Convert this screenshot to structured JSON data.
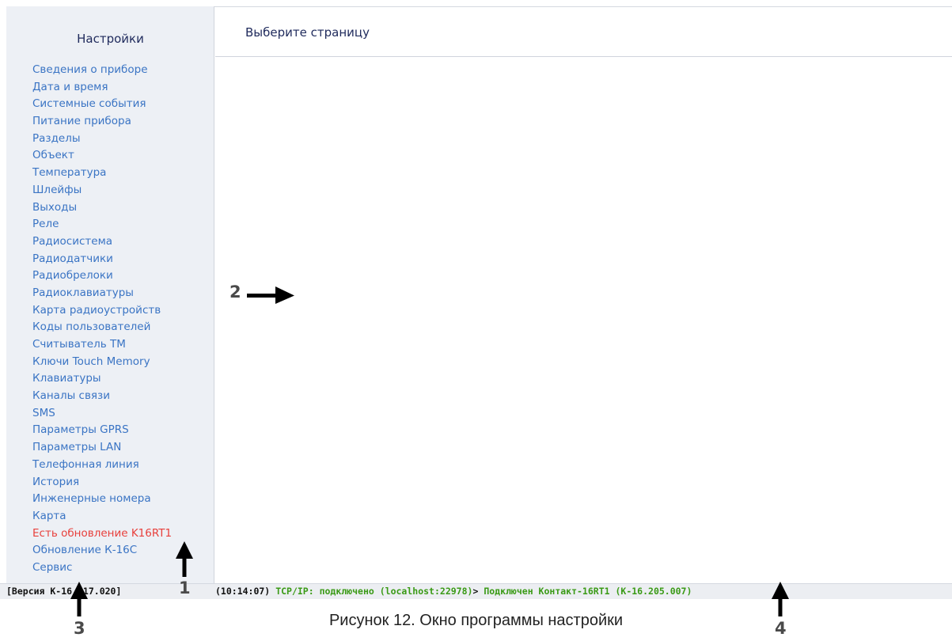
{
  "sidebar": {
    "title": "Настройки",
    "items": [
      {
        "label": "Сведения о приборе"
      },
      {
        "label": "Дата и время"
      },
      {
        "label": "Системные события"
      },
      {
        "label": "Питание прибора"
      },
      {
        "label": "Разделы"
      },
      {
        "label": "Объект"
      },
      {
        "label": "Температура"
      },
      {
        "label": "Шлейфы"
      },
      {
        "label": "Выходы"
      },
      {
        "label": "Реле"
      },
      {
        "label": "Радиосистема"
      },
      {
        "label": "Радиодатчики"
      },
      {
        "label": "Радиобрелоки"
      },
      {
        "label": "Радиоклавиатуры"
      },
      {
        "label": "Карта радиоустройств"
      },
      {
        "label": "Коды пользователей"
      },
      {
        "label": "Считыватель ТМ"
      },
      {
        "label": "Ключи Touch Memory"
      },
      {
        "label": "Клавиатуры"
      },
      {
        "label": "Каналы связи"
      },
      {
        "label": "SMS"
      },
      {
        "label": "Параметры GPRS"
      },
      {
        "label": "Параметры LAN"
      },
      {
        "label": "Телефонная линия"
      },
      {
        "label": "История"
      },
      {
        "label": "Инженерные номера"
      },
      {
        "label": "Карта"
      },
      {
        "label": "Есть обновление K16RT1"
      },
      {
        "label": "Обновление К-16С"
      },
      {
        "label": "Сервис"
      }
    ]
  },
  "main": {
    "header_title": "Выберите страницу"
  },
  "statusbar": {
    "version": "[Версия К-16.017.020]",
    "time": "(10:14:07)",
    "tcp": "TCP/IP: подключено (localhost:22978)",
    "separator": ">",
    "device": "Подключен Контакт-16RT1 (К-16.205.007)"
  },
  "annotations": {
    "marker_1": "1",
    "marker_2": "2",
    "marker_3": "3",
    "marker_4": "4"
  },
  "caption": "Рисунок 12.  Окно программы настройки",
  "colors": {
    "link": "#3a74c4",
    "alert": "#e8403c",
    "status_ok": "#3a9a16",
    "sidebar_bg": "#edf0f5",
    "title": "#1f2a5c"
  }
}
